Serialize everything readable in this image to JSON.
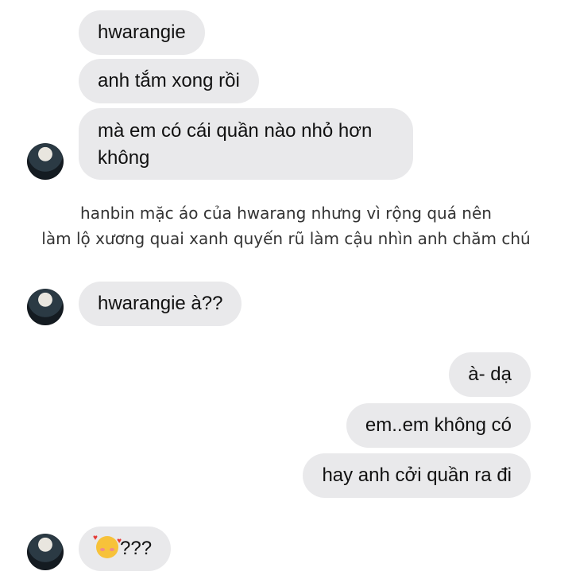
{
  "messages": {
    "m1": "hwarangie",
    "m2": "anh tắm xong rồi",
    "m3_line1": "mà em có cái quần nào nhỏ hơn",
    "m3_line2": "không",
    "m4": "hwarangie à??",
    "m5": "à- dạ",
    "m6": "em..em không có",
    "m7": "hay anh cởi quần ra đi",
    "m8": "???"
  },
  "narration": {
    "line1": "hanbin mặc áo của hwarang nhưng vì rộng quá nên",
    "line2": "làm lộ xương quai xanh quyến rũ làm cậu nhìn anh chăm chú"
  },
  "icons": {
    "avatar": "avatar",
    "emoji": "smiling-face-with-hearts-icon"
  },
  "colors": {
    "bubble": "#e9e9eb",
    "background": "#ffffff",
    "text": "#111111"
  }
}
